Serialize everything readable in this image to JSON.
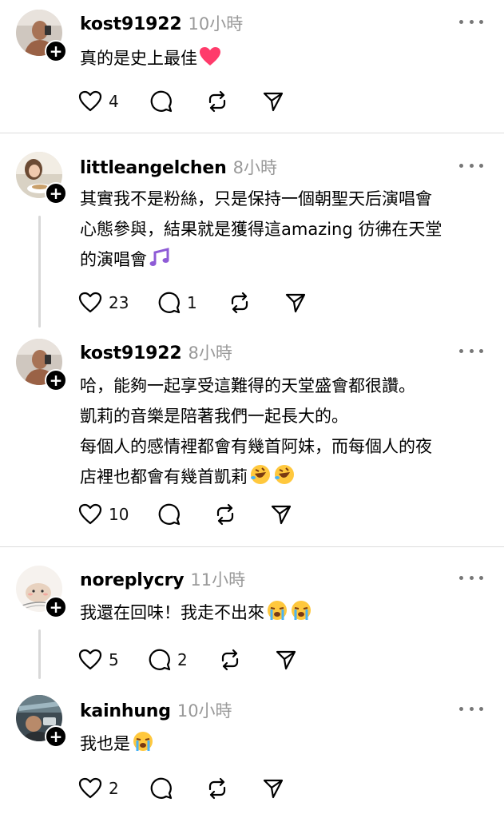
{
  "posts": [
    {
      "username": "kost91922",
      "time": "10小時",
      "text": "真的是史上最佳",
      "likes": "4",
      "replies": "",
      "emojis": [
        "heart-emoji"
      ]
    },
    {
      "username": "littleangelchen",
      "time": "8小時",
      "text": "其實我不是粉絲，只是保持一個朝聖天后演唱會\n心態參與，結果就是獲得這amazing 彷彿在天堂\n的演唱會",
      "likes": "23",
      "replies": "1",
      "emojis": [
        "music-notes-emoji"
      ]
    },
    {
      "username": "kost91922",
      "time": "8小時",
      "text": "哈，能夠一起享受這難得的天堂盛會都很讚。\n凱莉的音樂是陪著我們一起長大的。\n每個人的感情裡都會有幾首阿妹，而每個人的夜\n店裡也都會有幾首凱莉",
      "likes": "10",
      "replies": "",
      "emojis": [
        "rofl-emoji",
        "rofl-emoji"
      ]
    },
    {
      "username": "noreplycry",
      "time": "11小時",
      "text": "我還在回味！我走不出來",
      "likes": "5",
      "replies": "2",
      "emojis": [
        "crying-emoji",
        "crying-emoji"
      ]
    },
    {
      "username": "kainhung",
      "time": "10小時",
      "text": "我也是",
      "likes": "2",
      "replies": "",
      "emojis": [
        "crying-emoji"
      ]
    }
  ],
  "colors": {
    "text": "#000000",
    "muted": "#999999",
    "divider": "#dcdcdc",
    "heart": "#ff3b6b"
  }
}
